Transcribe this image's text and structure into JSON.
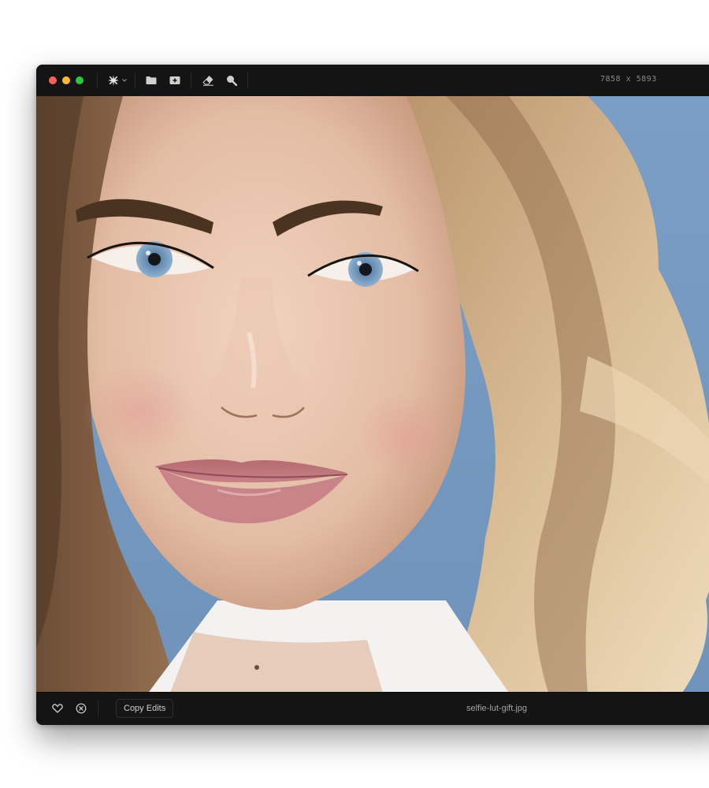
{
  "window": {
    "traffic_lights": [
      "close",
      "minimize",
      "zoom"
    ],
    "colors": {
      "close": "#ff5f57",
      "minimize": "#febc2e",
      "zoom": "#28c840",
      "chrome": "#141414"
    }
  },
  "toolbar": {
    "tools": [
      {
        "icon": "sparkle-icon",
        "has_dropdown": true
      },
      {
        "icon": "folder-icon"
      },
      {
        "icon": "add-image-icon"
      },
      {
        "icon": "eraser-icon"
      },
      {
        "icon": "search-icon"
      }
    ],
    "image_dimensions": "7858 x 5893"
  },
  "canvas": {
    "image_alt": "portrait photo",
    "background_color": "#7a9bc0"
  },
  "bottom_bar": {
    "favorite_icon": "heart-icon",
    "reject_icon": "circle-x-icon",
    "copy_edits_label": "Copy Edits",
    "filename": "selfie-lut-gift.jpg"
  }
}
